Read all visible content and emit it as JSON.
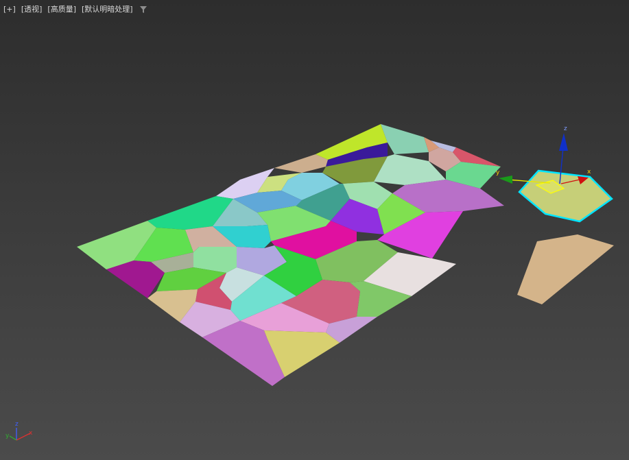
{
  "viewport": {
    "menu": {
      "plus": "[+]",
      "view": "[透视]",
      "quality": "[高质量]",
      "shading": "[默认明暗处理]"
    },
    "colors": {
      "background_top": "#2d2d2d",
      "background_bottom": "#4b4b4b",
      "selection_outline": "#00e5ff",
      "axis_x": "#d01010",
      "axis_y": "#1a9a1a",
      "axis_z": "#1030c8",
      "gizmo_plane": "#ffff00"
    },
    "icons": [
      "filter-icon",
      "transform-gizmo",
      "axis-tripod-icon"
    ]
  },
  "gizmo": {
    "x_label": "x",
    "y_label": "y",
    "z_label": "z"
  },
  "axis_tripod": {
    "x_label": "x",
    "y_label": "y",
    "z_label": "z"
  }
}
